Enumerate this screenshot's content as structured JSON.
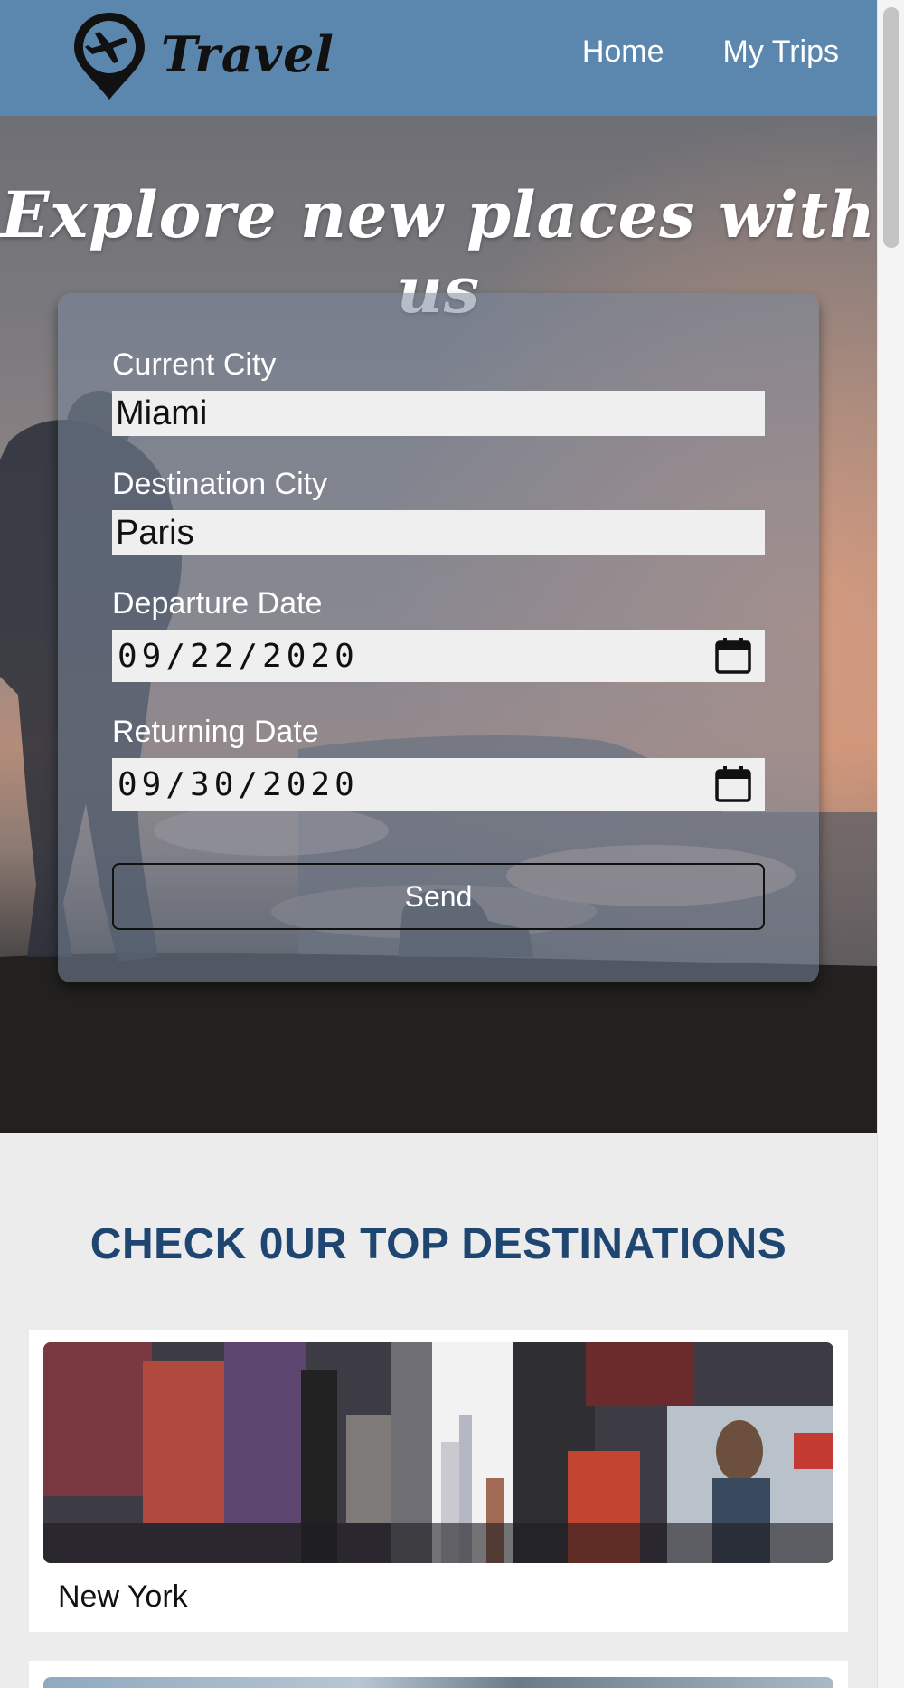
{
  "header": {
    "logo_text": "Travel",
    "nav": [
      {
        "label": "Home"
      },
      {
        "label": "My Trips"
      }
    ]
  },
  "hero": {
    "title": "Explore new places with us"
  },
  "form": {
    "current_city": {
      "label": "Current City",
      "value": "Miami"
    },
    "destination_city": {
      "label": "Destination City",
      "value": "Paris"
    },
    "departure_date": {
      "label": "Departure Date",
      "value": "09/22/2020"
    },
    "returning_date": {
      "label": "Returning Date",
      "value": "09/30/2020"
    },
    "send_label": "Send"
  },
  "destinations": {
    "title": "CHECK 0UR TOP DESTINATIONS",
    "items": [
      {
        "name": "New York"
      }
    ]
  },
  "colors": {
    "header_bg": "#5b87ae",
    "title_blue": "#1f4571"
  }
}
